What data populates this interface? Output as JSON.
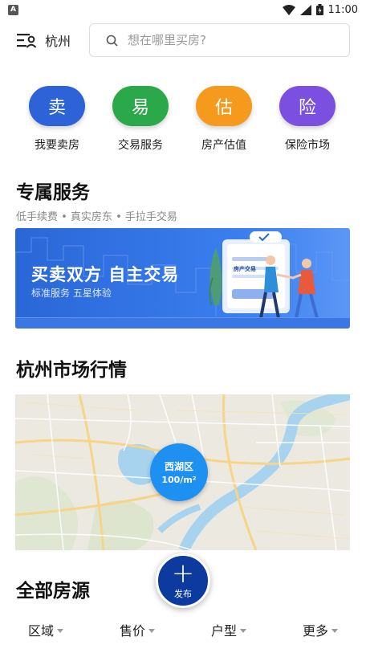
{
  "status_bar": {
    "app_icon_letter": "A",
    "time": "11:00"
  },
  "header": {
    "city": "杭州",
    "search": {
      "placeholder": "想在哪里买房?",
      "value": ""
    }
  },
  "quick_services": [
    {
      "glyph": "卖",
      "label": "我要卖房",
      "color": "#2e63d8",
      "icon": "sell-icon"
    },
    {
      "glyph": "易",
      "label": "交易服务",
      "color": "#2aa84a",
      "icon": "trade-icon"
    },
    {
      "glyph": "估",
      "label": "房产估值",
      "color": "#f59a1c",
      "icon": "valuation-icon"
    },
    {
      "glyph": "险",
      "label": "保险市场",
      "color": "#7b4fe0",
      "icon": "insurance-icon"
    }
  ],
  "exclusive": {
    "title": "专属服务",
    "subtitle": "低手续费 • 真实房东 • 手拉手交易",
    "banner": {
      "title": "买卖双方 自主交易",
      "subtitle": "标准服务 五星体验",
      "card_text": "房产交易"
    }
  },
  "market": {
    "title": "杭州市场行情",
    "district": {
      "name": "西湖区",
      "price": "100/m²"
    }
  },
  "listings": {
    "title": "全部房源"
  },
  "fab": {
    "label": "发布"
  },
  "filters": [
    {
      "label": "区域"
    },
    {
      "label": "售价"
    },
    {
      "label": "户型"
    },
    {
      "label": "更多"
    }
  ],
  "colors": {
    "accent": "#0d3a9e",
    "banner": "#3b7ff0",
    "map_marker": "#1e90f2"
  }
}
